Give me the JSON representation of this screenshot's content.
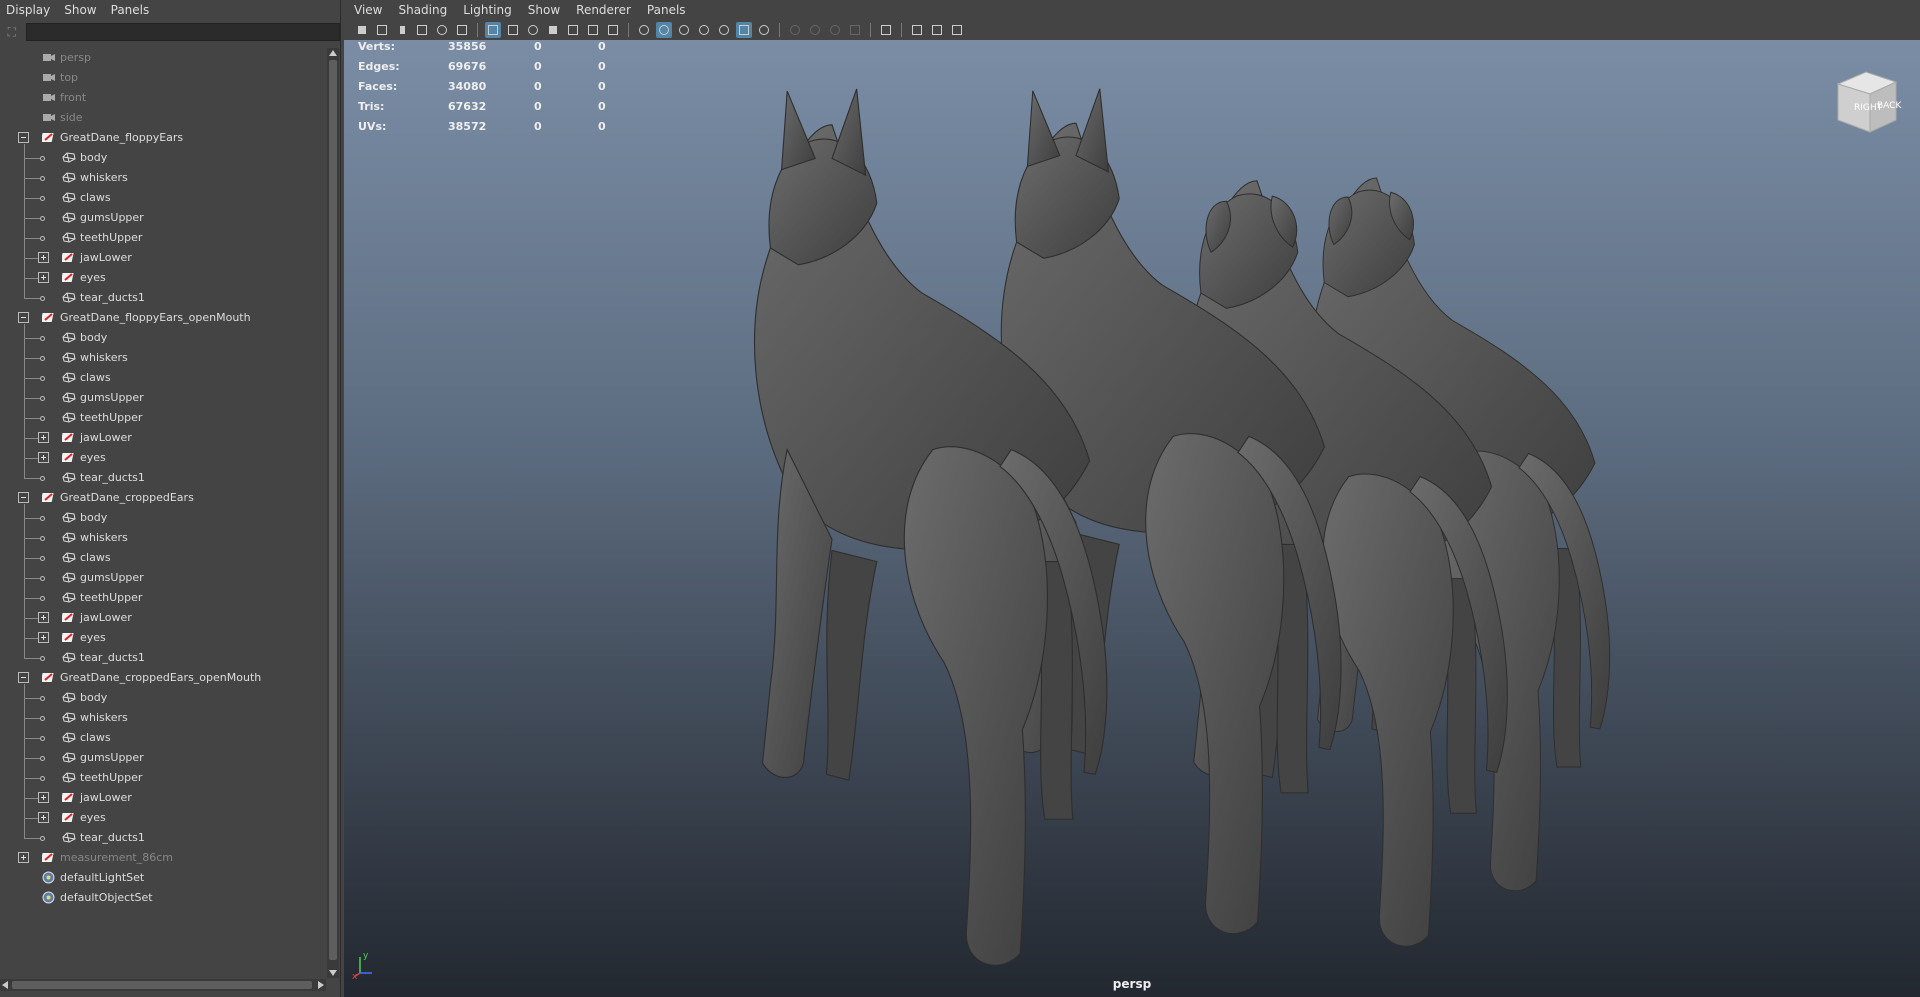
{
  "outliner": {
    "menu": [
      "Display",
      "Show",
      "Panels"
    ],
    "search_placeholder": "",
    "cameras": [
      "persp",
      "top",
      "front",
      "side"
    ],
    "groups": [
      {
        "name": "GreatDane_floppyEars",
        "children": [
          "body",
          "whiskers",
          "claws",
          "gumsUpper",
          "teethUpper",
          "jawLower",
          "eyes",
          "tear_ducts1"
        ]
      },
      {
        "name": "GreatDane_floppyEars_openMouth",
        "children": [
          "body",
          "whiskers",
          "claws",
          "gumsUpper",
          "teethUpper",
          "jawLower",
          "eyes",
          "tear_ducts1"
        ]
      },
      {
        "name": "GreatDane_croppedEars",
        "children": [
          "body",
          "whiskers",
          "claws",
          "gumsUpper",
          "teethUpper",
          "jawLower",
          "eyes",
          "tear_ducts1"
        ]
      },
      {
        "name": "GreatDane_croppedEars_openMouth",
        "children": [
          "body",
          "whiskers",
          "claws",
          "gumsUpper",
          "teethUpper",
          "jawLower",
          "eyes",
          "tear_ducts1"
        ]
      }
    ],
    "extra": [
      "measurement_86cm",
      "defaultLightSet",
      "defaultObjectSet"
    ]
  },
  "viewport": {
    "menu": [
      "View",
      "Shading",
      "Lighting",
      "Show",
      "Renderer",
      "Panels"
    ],
    "hud": [
      {
        "label": "Verts:",
        "v1": "35856",
        "v2": "0",
        "v3": "0"
      },
      {
        "label": "Edges:",
        "v1": "69676",
        "v2": "0",
        "v3": "0"
      },
      {
        "label": "Faces:",
        "v1": "34080",
        "v2": "0",
        "v3": "0"
      },
      {
        "label": "Tris:",
        "v1": "67632",
        "v2": "0",
        "v3": "0"
      },
      {
        "label": "UVs:",
        "v1": "38572",
        "v2": "0",
        "v3": "0"
      }
    ],
    "viewcube_faces": [
      "RIGHT",
      "BACK"
    ],
    "camera": "persp",
    "axis_labels": [
      "y",
      "x"
    ]
  },
  "colors": {
    "accent": "#5285a6",
    "panel": "#444444",
    "mesh": "#5a5a5a"
  }
}
